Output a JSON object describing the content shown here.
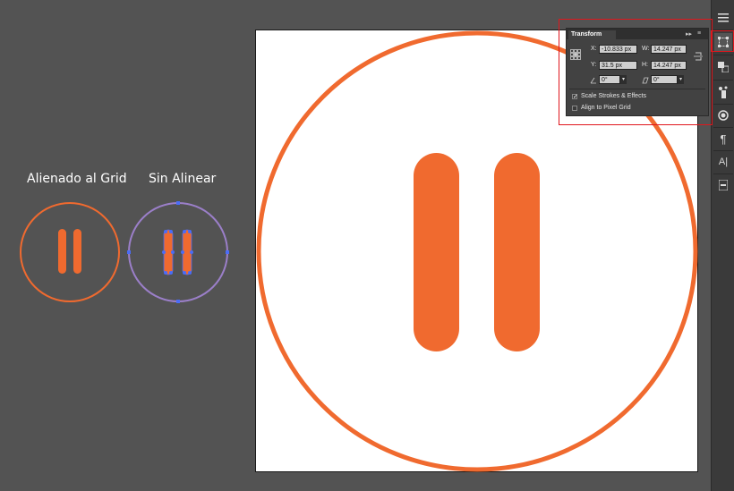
{
  "examples": {
    "aligned_label": "Alienado al Grid",
    "unaligned_label": "Sin Alinear"
  },
  "transform_panel": {
    "tab_title": "Transform",
    "x_label": "X:",
    "x_value": "-10.833 px",
    "y_label": "Y:",
    "y_value": "31.5 px",
    "w_label": "W:",
    "w_value": "14.247 px",
    "h_label": "H:",
    "h_value": "14.247 px",
    "rotate_value": "0°",
    "shear_value": "0°",
    "scale_strokes_label": "Scale Strokes & Effects",
    "scale_strokes_checked": true,
    "align_pixel_label": "Align to Pixel Grid",
    "align_pixel_checked": false
  },
  "toolbar": {
    "paragraph_glyph": "¶",
    "character_glyph": "A|"
  },
  "colors": {
    "accent_orange": "#f06a2f",
    "selection_blue": "#4a6cf7",
    "selection_purple": "#9b7fc9",
    "highlight_red": "#e0161c"
  }
}
